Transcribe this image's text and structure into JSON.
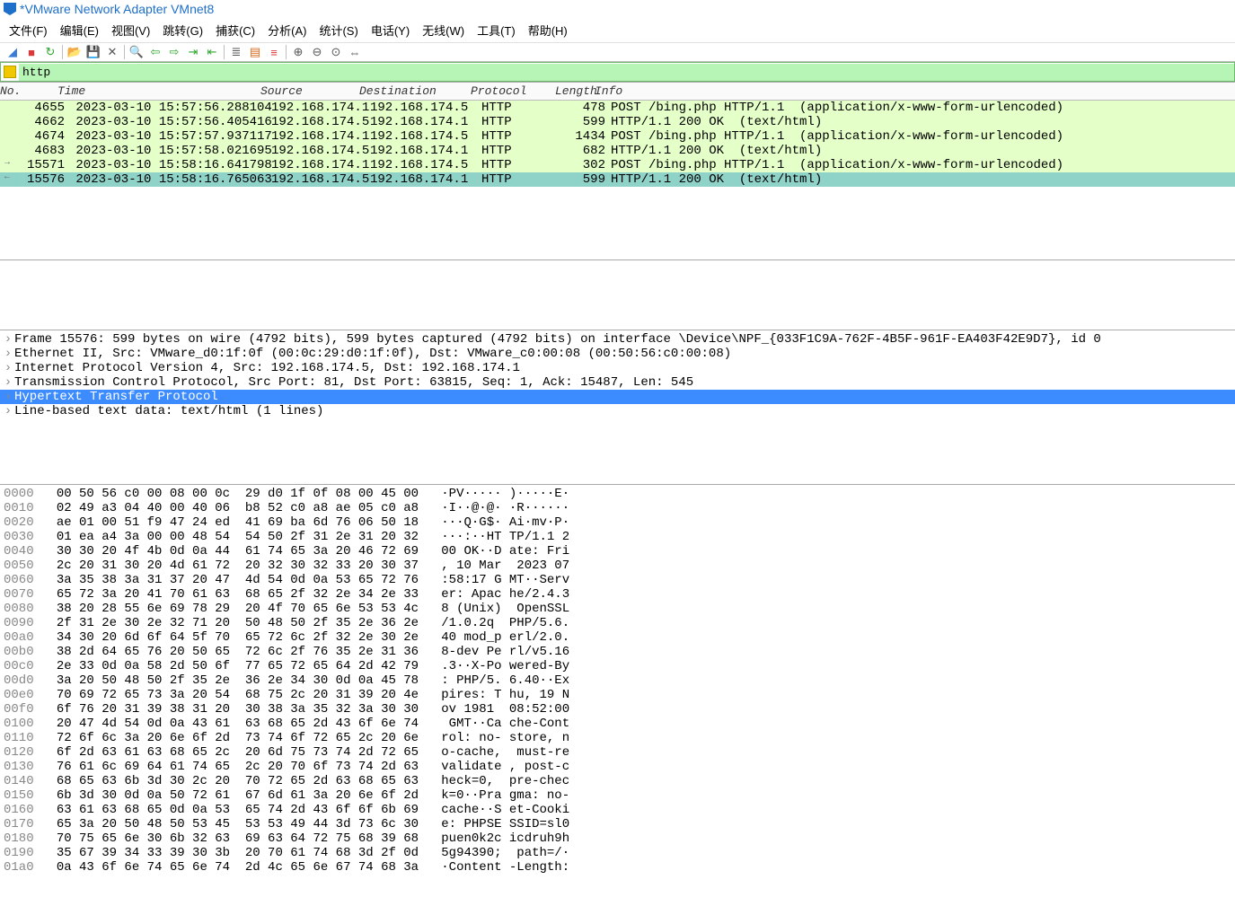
{
  "window_title": "*VMware Network Adapter VMnet8",
  "menu": [
    "文件(F)",
    "编辑(E)",
    "视图(V)",
    "跳转(G)",
    "捕获(C)",
    "分析(A)",
    "统计(S)",
    "电话(Y)",
    "无线(W)",
    "工具(T)",
    "帮助(H)"
  ],
  "filter_value": "http",
  "columns": [
    "No.",
    "Time",
    "Source",
    "Destination",
    "Protocol",
    "Length",
    "Info"
  ],
  "packets": [
    {
      "no": "4655",
      "time": "2023-03-10 15:57:56.288104",
      "src": "192.168.174.1",
      "dst": "192.168.174.5",
      "proto": "HTTP",
      "len": "478",
      "info": "POST /bing.php HTTP/1.1  (application/x-www-form-urlencoded)",
      "cls": "req",
      "arrow": ""
    },
    {
      "no": "4662",
      "time": "2023-03-10 15:57:56.405416",
      "src": "192.168.174.5",
      "dst": "192.168.174.1",
      "proto": "HTTP",
      "len": "599",
      "info": "HTTP/1.1 200 OK  (text/html)",
      "cls": "req",
      "arrow": ""
    },
    {
      "no": "4674",
      "time": "2023-03-10 15:57:57.937117",
      "src": "192.168.174.1",
      "dst": "192.168.174.5",
      "proto": "HTTP",
      "len": "1434",
      "info": "POST /bing.php HTTP/1.1  (application/x-www-form-urlencoded)",
      "cls": "req",
      "arrow": ""
    },
    {
      "no": "4683",
      "time": "2023-03-10 15:57:58.021695",
      "src": "192.168.174.5",
      "dst": "192.168.174.1",
      "proto": "HTTP",
      "len": "682",
      "info": "HTTP/1.1 200 OK  (text/html)",
      "cls": "req",
      "arrow": ""
    },
    {
      "no": "15571",
      "time": "2023-03-10 15:58:16.641798",
      "src": "192.168.174.1",
      "dst": "192.168.174.5",
      "proto": "HTTP",
      "len": "302",
      "info": "POST /bing.php HTTP/1.1  (application/x-www-form-urlencoded)",
      "cls": "req",
      "arrow": "→"
    },
    {
      "no": "15576",
      "time": "2023-03-10 15:58:16.765063",
      "src": "192.168.174.5",
      "dst": "192.168.174.1",
      "proto": "HTTP",
      "len": "599",
      "info": "HTTP/1.1 200 OK  (text/html)",
      "cls": "sel",
      "arrow": "←"
    }
  ],
  "details": [
    "Frame 15576: 599 bytes on wire (4792 bits), 599 bytes captured (4792 bits) on interface \\Device\\NPF_{033F1C9A-762F-4B5F-961F-EA403F42E9D7}, id 0",
    "Ethernet II, Src: VMware_d0:1f:0f (00:0c:29:d0:1f:0f), Dst: VMware_c0:00:08 (00:50:56:c0:00:08)",
    "Internet Protocol Version 4, Src: 192.168.174.5, Dst: 192.168.174.1",
    "Transmission Control Protocol, Src Port: 81, Dst Port: 63815, Seq: 1, Ack: 15487, Len: 545",
    "Hypertext Transfer Protocol",
    "Line-based text data: text/html (1 lines)"
  ],
  "details_selected_index": 4,
  "hex": [
    {
      "o": "0000",
      "h": "00 50 56 c0 00 08 00 0c  29 d0 1f 0f 08 00 45 00",
      "a": "·PV····· )·····E·"
    },
    {
      "o": "0010",
      "h": "02 49 a3 04 40 00 40 06  b8 52 c0 a8 ae 05 c0 a8",
      "a": "·I··@·@· ·R······"
    },
    {
      "o": "0020",
      "h": "ae 01 00 51 f9 47 24 ed  41 69 ba 6d 76 06 50 18",
      "a": "···Q·G$· Ai·mv·P·"
    },
    {
      "o": "0030",
      "h": "01 ea a4 3a 00 00 48 54  54 50 2f 31 2e 31 20 32",
      "a": "···:··HT TP/1.1 2"
    },
    {
      "o": "0040",
      "h": "30 30 20 4f 4b 0d 0a 44  61 74 65 3a 20 46 72 69",
      "a": "00 OK··D ate: Fri"
    },
    {
      "o": "0050",
      "h": "2c 20 31 30 20 4d 61 72  20 32 30 32 33 20 30 37",
      "a": ", 10 Mar  2023 07"
    },
    {
      "o": "0060",
      "h": "3a 35 38 3a 31 37 20 47  4d 54 0d 0a 53 65 72 76",
      "a": ":58:17 G MT··Serv"
    },
    {
      "o": "0070",
      "h": "65 72 3a 20 41 70 61 63  68 65 2f 32 2e 34 2e 33",
      "a": "er: Apac he/2.4.3"
    },
    {
      "o": "0080",
      "h": "38 20 28 55 6e 69 78 29  20 4f 70 65 6e 53 53 4c",
      "a": "8 (Unix)  OpenSSL"
    },
    {
      "o": "0090",
      "h": "2f 31 2e 30 2e 32 71 20  50 48 50 2f 35 2e 36 2e",
      "a": "/1.0.2q  PHP/5.6."
    },
    {
      "o": "00a0",
      "h": "34 30 20 6d 6f 64 5f 70  65 72 6c 2f 32 2e 30 2e",
      "a": "40 mod_p erl/2.0."
    },
    {
      "o": "00b0",
      "h": "38 2d 64 65 76 20 50 65  72 6c 2f 76 35 2e 31 36",
      "a": "8-dev Pe rl/v5.16"
    },
    {
      "o": "00c0",
      "h": "2e 33 0d 0a 58 2d 50 6f  77 65 72 65 64 2d 42 79",
      "a": ".3··X-Po wered-By"
    },
    {
      "o": "00d0",
      "h": "3a 20 50 48 50 2f 35 2e  36 2e 34 30 0d 0a 45 78",
      "a": ": PHP/5. 6.40··Ex"
    },
    {
      "o": "00e0",
      "h": "70 69 72 65 73 3a 20 54  68 75 2c 20 31 39 20 4e",
      "a": "pires: T hu, 19 N"
    },
    {
      "o": "00f0",
      "h": "6f 76 20 31 39 38 31 20  30 38 3a 35 32 3a 30 30",
      "a": "ov 1981  08:52:00"
    },
    {
      "o": "0100",
      "h": "20 47 4d 54 0d 0a 43 61  63 68 65 2d 43 6f 6e 74",
      "a": " GMT··Ca che-Cont"
    },
    {
      "o": "0110",
      "h": "72 6f 6c 3a 20 6e 6f 2d  73 74 6f 72 65 2c 20 6e",
      "a": "rol: no- store, n"
    },
    {
      "o": "0120",
      "h": "6f 2d 63 61 63 68 65 2c  20 6d 75 73 74 2d 72 65",
      "a": "o-cache,  must-re"
    },
    {
      "o": "0130",
      "h": "76 61 6c 69 64 61 74 65  2c 20 70 6f 73 74 2d 63",
      "a": "validate , post-c"
    },
    {
      "o": "0140",
      "h": "68 65 63 6b 3d 30 2c 20  70 72 65 2d 63 68 65 63",
      "a": "heck=0,  pre-chec"
    },
    {
      "o": "0150",
      "h": "6b 3d 30 0d 0a 50 72 61  67 6d 61 3a 20 6e 6f 2d",
      "a": "k=0··Pra gma: no-"
    },
    {
      "o": "0160",
      "h": "63 61 63 68 65 0d 0a 53  65 74 2d 43 6f 6f 6b 69",
      "a": "cache··S et-Cooki"
    },
    {
      "o": "0170",
      "h": "65 3a 20 50 48 50 53 45  53 53 49 44 3d 73 6c 30",
      "a": "e: PHPSE SSID=sl0"
    },
    {
      "o": "0180",
      "h": "70 75 65 6e 30 6b 32 63  69 63 64 72 75 68 39 68",
      "a": "puen0k2c icdruh9h"
    },
    {
      "o": "0190",
      "h": "35 67 39 34 33 39 30 3b  20 70 61 74 68 3d 2f 0d",
      "a": "5g94390;  path=/·"
    },
    {
      "o": "01a0",
      "h": "0a 43 6f 6e 74 65 6e 74  2d 4c 65 6e 67 74 68 3a",
      "a": "·Content -Length:"
    }
  ]
}
